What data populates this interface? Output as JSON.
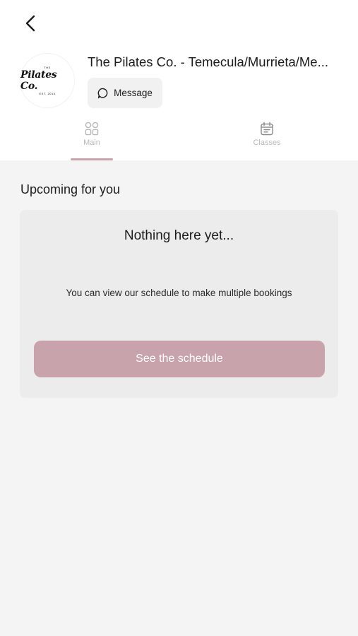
{
  "header": {
    "back_icon": "chevron-left-icon",
    "logo": {
      "top_text": "THE",
      "brand_text": "Pilates Co.",
      "est_text": "EST. 2014"
    },
    "studio_name": "The Pilates Co. - Temecula/Murrieta/Me...",
    "message_label": "Message"
  },
  "tabs": [
    {
      "label": "Main",
      "icon": "grid-icon",
      "active": true
    },
    {
      "label": "Classes",
      "icon": "calendar-icon",
      "active": false
    }
  ],
  "upcoming": {
    "title": "Upcoming for you",
    "empty_title": "Nothing here yet...",
    "empty_text": "You can view our schedule to make multiple bookings",
    "cta_label": "See the schedule"
  },
  "colors": {
    "accent": "#c8a3ab",
    "background": "#f4f4f4",
    "card": "#ececec"
  }
}
